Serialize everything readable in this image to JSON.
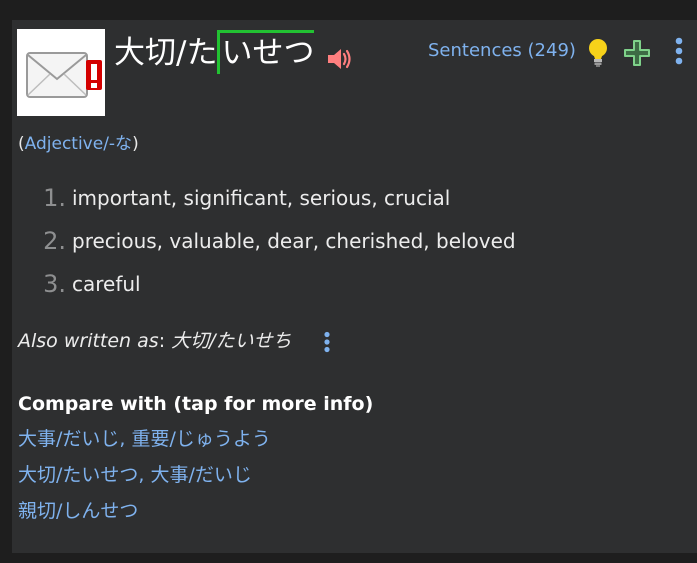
{
  "entry": {
    "headword_prefix": "大切/た",
    "headword_marked": "いせつ",
    "thumbnail_icon": "envelope-alert-icon",
    "speaker_icon": "speaker-icon",
    "colors": {
      "link": "#7fb2ee",
      "accent_mark": "#22c232",
      "speaker": "#ff7f7f",
      "bulb": "#f7d21a",
      "plus": "#7fd28a"
    }
  },
  "toolbar": {
    "sentences_label": "Sentences (249)",
    "bulb_icon": "lightbulb-icon",
    "plus_icon": "plus-icon",
    "menu_icon": "vertical-dots-icon"
  },
  "part_of_speech": {
    "open": "(",
    "label": "Adjective/-な",
    "close": ")"
  },
  "definitions": [
    {
      "num": "1.",
      "text": "important, significant, serious, crucial"
    },
    {
      "num": "2.",
      "text": "precious, valuable, dear, cherished, beloved"
    },
    {
      "num": "3.",
      "text": "careful"
    }
  ],
  "also_written": {
    "label": "Also written as",
    "sep": ": ",
    "value": "大切/たいせち"
  },
  "compare": {
    "title": "Compare with (tap for more info)",
    "items": [
      "大事/だいじ, 重要/じゅうよう",
      "大切/たいせつ, 大事/だいじ",
      "親切/しんせつ"
    ]
  }
}
